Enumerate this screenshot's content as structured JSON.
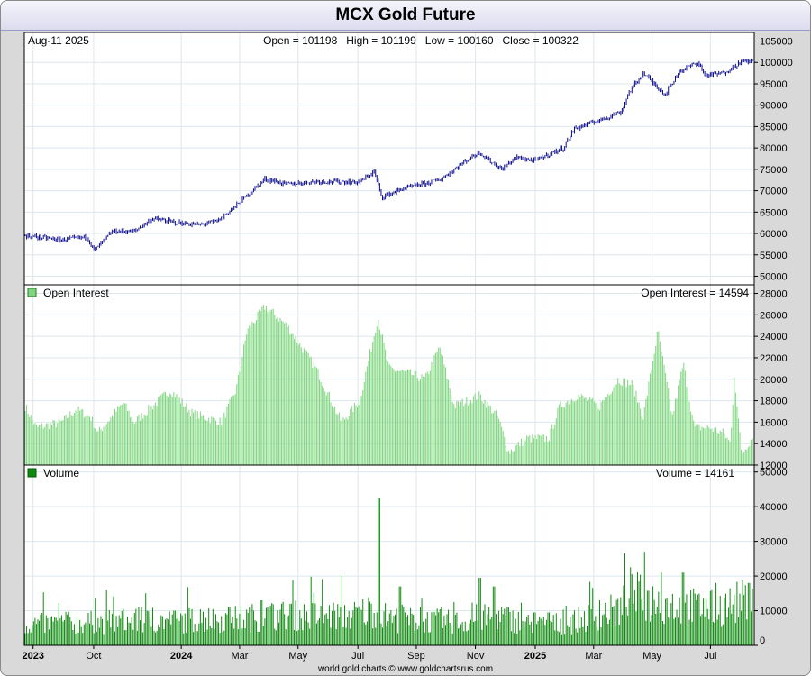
{
  "title": "MCX Gold Future",
  "footer": "world gold charts © www.goldchartsrus.com",
  "price_panel": {
    "date": "Aug-11  2025",
    "ohlc": "Open = 101198   High = 101199   Low = 100160   Close = 100322",
    "y_ticks": [
      "105000",
      "100000",
      "95000",
      "90000",
      "85000",
      "80000",
      "75000",
      "70000",
      "65000",
      "60000",
      "55000",
      "50000"
    ]
  },
  "oi_panel": {
    "label": "Open Interest",
    "readout": "Open Interest = 14594",
    "y_ticks": [
      "28000",
      "26000",
      "24000",
      "22000",
      "20000",
      "18000",
      "16000",
      "14000",
      "12000"
    ]
  },
  "vol_panel": {
    "label": "Volume",
    "readout": "Volume = 14161",
    "y_ticks": [
      "50000",
      "40000",
      "30000",
      "20000",
      "10000",
      "0"
    ]
  },
  "x_ticks": [
    {
      "label": "2023",
      "bold": true
    },
    {
      "label": "Oct",
      "bold": false
    },
    {
      "label": "2024",
      "bold": true
    },
    {
      "label": "Mar",
      "bold": false
    },
    {
      "label": "May",
      "bold": false
    },
    {
      "label": "Jul",
      "bold": false
    },
    {
      "label": "Sep",
      "bold": false
    },
    {
      "label": "Nov",
      "bold": false
    },
    {
      "label": "2025",
      "bold": true
    },
    {
      "label": "Mar",
      "bold": false
    },
    {
      "label": "May",
      "bold": false
    },
    {
      "label": "Jul",
      "bold": false
    }
  ],
  "colors": {
    "price": "#0a0a8c",
    "open_interest": "#7fd67f",
    "volume": "#0f8a0f",
    "grid": "#dde7ee"
  },
  "chart_data": [
    {
      "type": "line",
      "title": "MCX Gold Future",
      "series_label": "",
      "ylim": [
        48000,
        107000
      ],
      "x_range": [
        0,
        1
      ],
      "anchors": [
        [
          0.0,
          59500
        ],
        [
          0.05,
          58500
        ],
        [
          0.085,
          59200
        ],
        [
          0.095,
          56000
        ],
        [
          0.12,
          60500
        ],
        [
          0.15,
          60500
        ],
        [
          0.175,
          63500
        ],
        [
          0.21,
          62500
        ],
        [
          0.24,
          62000
        ],
        [
          0.265,
          63000
        ],
        [
          0.29,
          66500
        ],
        [
          0.33,
          72800
        ],
        [
          0.36,
          71500
        ],
        [
          0.4,
          72200
        ],
        [
          0.46,
          72000
        ],
        [
          0.48,
          74500
        ],
        [
          0.49,
          68500
        ],
        [
          0.52,
          70500
        ],
        [
          0.57,
          72500
        ],
        [
          0.61,
          77500
        ],
        [
          0.625,
          79000
        ],
        [
          0.635,
          77500
        ],
        [
          0.655,
          75000
        ],
        [
          0.675,
          77800
        ],
        [
          0.7,
          77000
        ],
        [
          0.74,
          80000
        ],
        [
          0.755,
          84500
        ],
        [
          0.79,
          86500
        ],
        [
          0.82,
          88500
        ],
        [
          0.83,
          93000
        ],
        [
          0.85,
          97500
        ],
        [
          0.88,
          92500
        ],
        [
          0.9,
          98000
        ],
        [
          0.925,
          100000
        ],
        [
          0.935,
          97000
        ],
        [
          0.96,
          97500
        ],
        [
          0.985,
          100200
        ],
        [
          1.0,
          100322
        ]
      ]
    },
    {
      "type": "bar",
      "title": "Open Interest",
      "ylim": [
        12000,
        28800
      ],
      "x_range": [
        0,
        1
      ],
      "anchors": [
        [
          0.0,
          17500
        ],
        [
          0.015,
          15500
        ],
        [
          0.05,
          16000
        ],
        [
          0.07,
          17200
        ],
        [
          0.09,
          16500
        ],
        [
          0.1,
          15000
        ],
        [
          0.135,
          17800
        ],
        [
          0.15,
          16000
        ],
        [
          0.175,
          17500
        ],
        [
          0.2,
          19000
        ],
        [
          0.23,
          16800
        ],
        [
          0.27,
          16000
        ],
        [
          0.29,
          19000
        ],
        [
          0.305,
          24500
        ],
        [
          0.33,
          26800
        ],
        [
          0.36,
          25000
        ],
        [
          0.4,
          21000
        ],
        [
          0.435,
          16000
        ],
        [
          0.46,
          18000
        ],
        [
          0.485,
          25800
        ],
        [
          0.5,
          21000
        ],
        [
          0.53,
          20500
        ],
        [
          0.55,
          20000
        ],
        [
          0.56,
          21500
        ],
        [
          0.57,
          23000
        ],
        [
          0.59,
          17500
        ],
        [
          0.625,
          18500
        ],
        [
          0.65,
          16500
        ],
        [
          0.665,
          13200
        ],
        [
          0.69,
          14500
        ],
        [
          0.72,
          14500
        ],
        [
          0.735,
          17500
        ],
        [
          0.76,
          18500
        ],
        [
          0.79,
          17500
        ],
        [
          0.815,
          20000
        ],
        [
          0.835,
          19500
        ],
        [
          0.85,
          16500
        ],
        [
          0.87,
          24500
        ],
        [
          0.89,
          16500
        ],
        [
          0.905,
          21500
        ],
        [
          0.92,
          15500
        ],
        [
          0.94,
          15500
        ],
        [
          0.96,
          15000
        ],
        [
          0.97,
          14000
        ],
        [
          0.975,
          20500
        ],
        [
          0.985,
          13000
        ],
        [
          1.0,
          14594
        ]
      ]
    },
    {
      "type": "bar",
      "title": "Volume",
      "ylim": [
        0,
        52000
      ],
      "x_range": [
        0,
        1
      ],
      "anchors": [
        [
          0.0,
          6500
        ],
        [
          0.1,
          7000
        ],
        [
          0.2,
          7500
        ],
        [
          0.29,
          8000
        ],
        [
          0.34,
          9000
        ],
        [
          0.45,
          9000
        ],
        [
          0.48,
          11000
        ],
        [
          0.5,
          8000
        ],
        [
          0.6,
          7000
        ],
        [
          0.65,
          9000
        ],
        [
          0.7,
          6000
        ],
        [
          0.75,
          7000
        ],
        [
          0.8,
          10000
        ],
        [
          0.82,
          11000
        ],
        [
          0.83,
          16000
        ],
        [
          0.85,
          14000
        ],
        [
          0.9,
          12000
        ],
        [
          0.95,
          11000
        ],
        [
          1.0,
          14161
        ]
      ],
      "spikes": [
        [
          0.096,
          13500
        ],
        [
          0.135,
          10500
        ],
        [
          0.16,
          11000
        ],
        [
          0.205,
          10000
        ],
        [
          0.28,
          11000
        ],
        [
          0.325,
          13000
        ],
        [
          0.365,
          12000
        ],
        [
          0.487,
          42500
        ],
        [
          0.515,
          17000
        ],
        [
          0.59,
          12500
        ],
        [
          0.625,
          19500
        ],
        [
          0.645,
          17000
        ],
        [
          0.7,
          9500
        ],
        [
          0.72,
          9500
        ],
        [
          0.79,
          13000
        ],
        [
          0.825,
          26500
        ],
        [
          0.852,
          27000
        ],
        [
          0.875,
          21000
        ],
        [
          0.905,
          21000
        ],
        [
          0.95,
          18000
        ],
        [
          0.995,
          18000
        ]
      ]
    }
  ]
}
